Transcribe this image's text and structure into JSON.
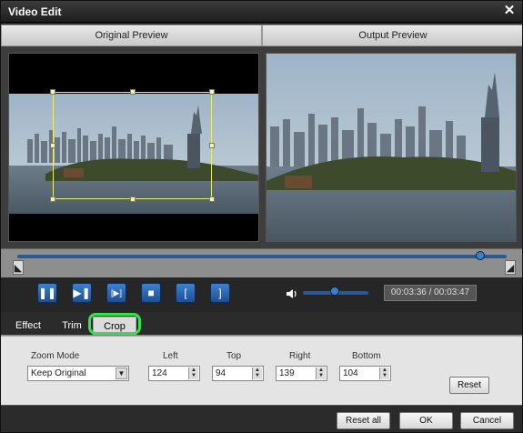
{
  "window": {
    "title": "Video Edit",
    "close_glyph": "✕"
  },
  "previews": {
    "original_label": "Original Preview",
    "output_label": "Output Preview"
  },
  "timeline": {
    "position_fraction": 0.947,
    "start_marker": "◣",
    "end_marker": "◢"
  },
  "playback": {
    "buttons": [
      {
        "name": "pause-button",
        "glyph": "❚❚"
      },
      {
        "name": "next-frame-button",
        "glyph": "▶❚"
      },
      {
        "name": "play-segment-button",
        "glyph": "[▶]"
      },
      {
        "name": "stop-button",
        "glyph": "■"
      },
      {
        "name": "set-start-button",
        "glyph": "["
      },
      {
        "name": "set-end-button",
        "glyph": "]"
      }
    ],
    "volume_fraction": 0.48,
    "time_display": "00:03:36 / 00:03:47"
  },
  "tabs": [
    {
      "label": "Effect",
      "active": false
    },
    {
      "label": "Trim",
      "active": false
    },
    {
      "label": "Crop",
      "active": true
    }
  ],
  "crop": {
    "zoom_mode_label": "Zoom Mode",
    "zoom_mode_value": "Keep Original",
    "left_label": "Left",
    "left_value": "124",
    "top_label": "Top",
    "top_value": "94",
    "right_label": "Right",
    "right_value": "139",
    "bottom_label": "Bottom",
    "bottom_value": "104",
    "reset_label": "Reset"
  },
  "footer": {
    "reset_all_label": "Reset all",
    "ok_label": "OK",
    "cancel_label": "Cancel"
  },
  "colors": {
    "highlight_outline": "#2fe34c",
    "crop_frame": "#e6f06a",
    "accent_blue": "#3b7ed3"
  }
}
